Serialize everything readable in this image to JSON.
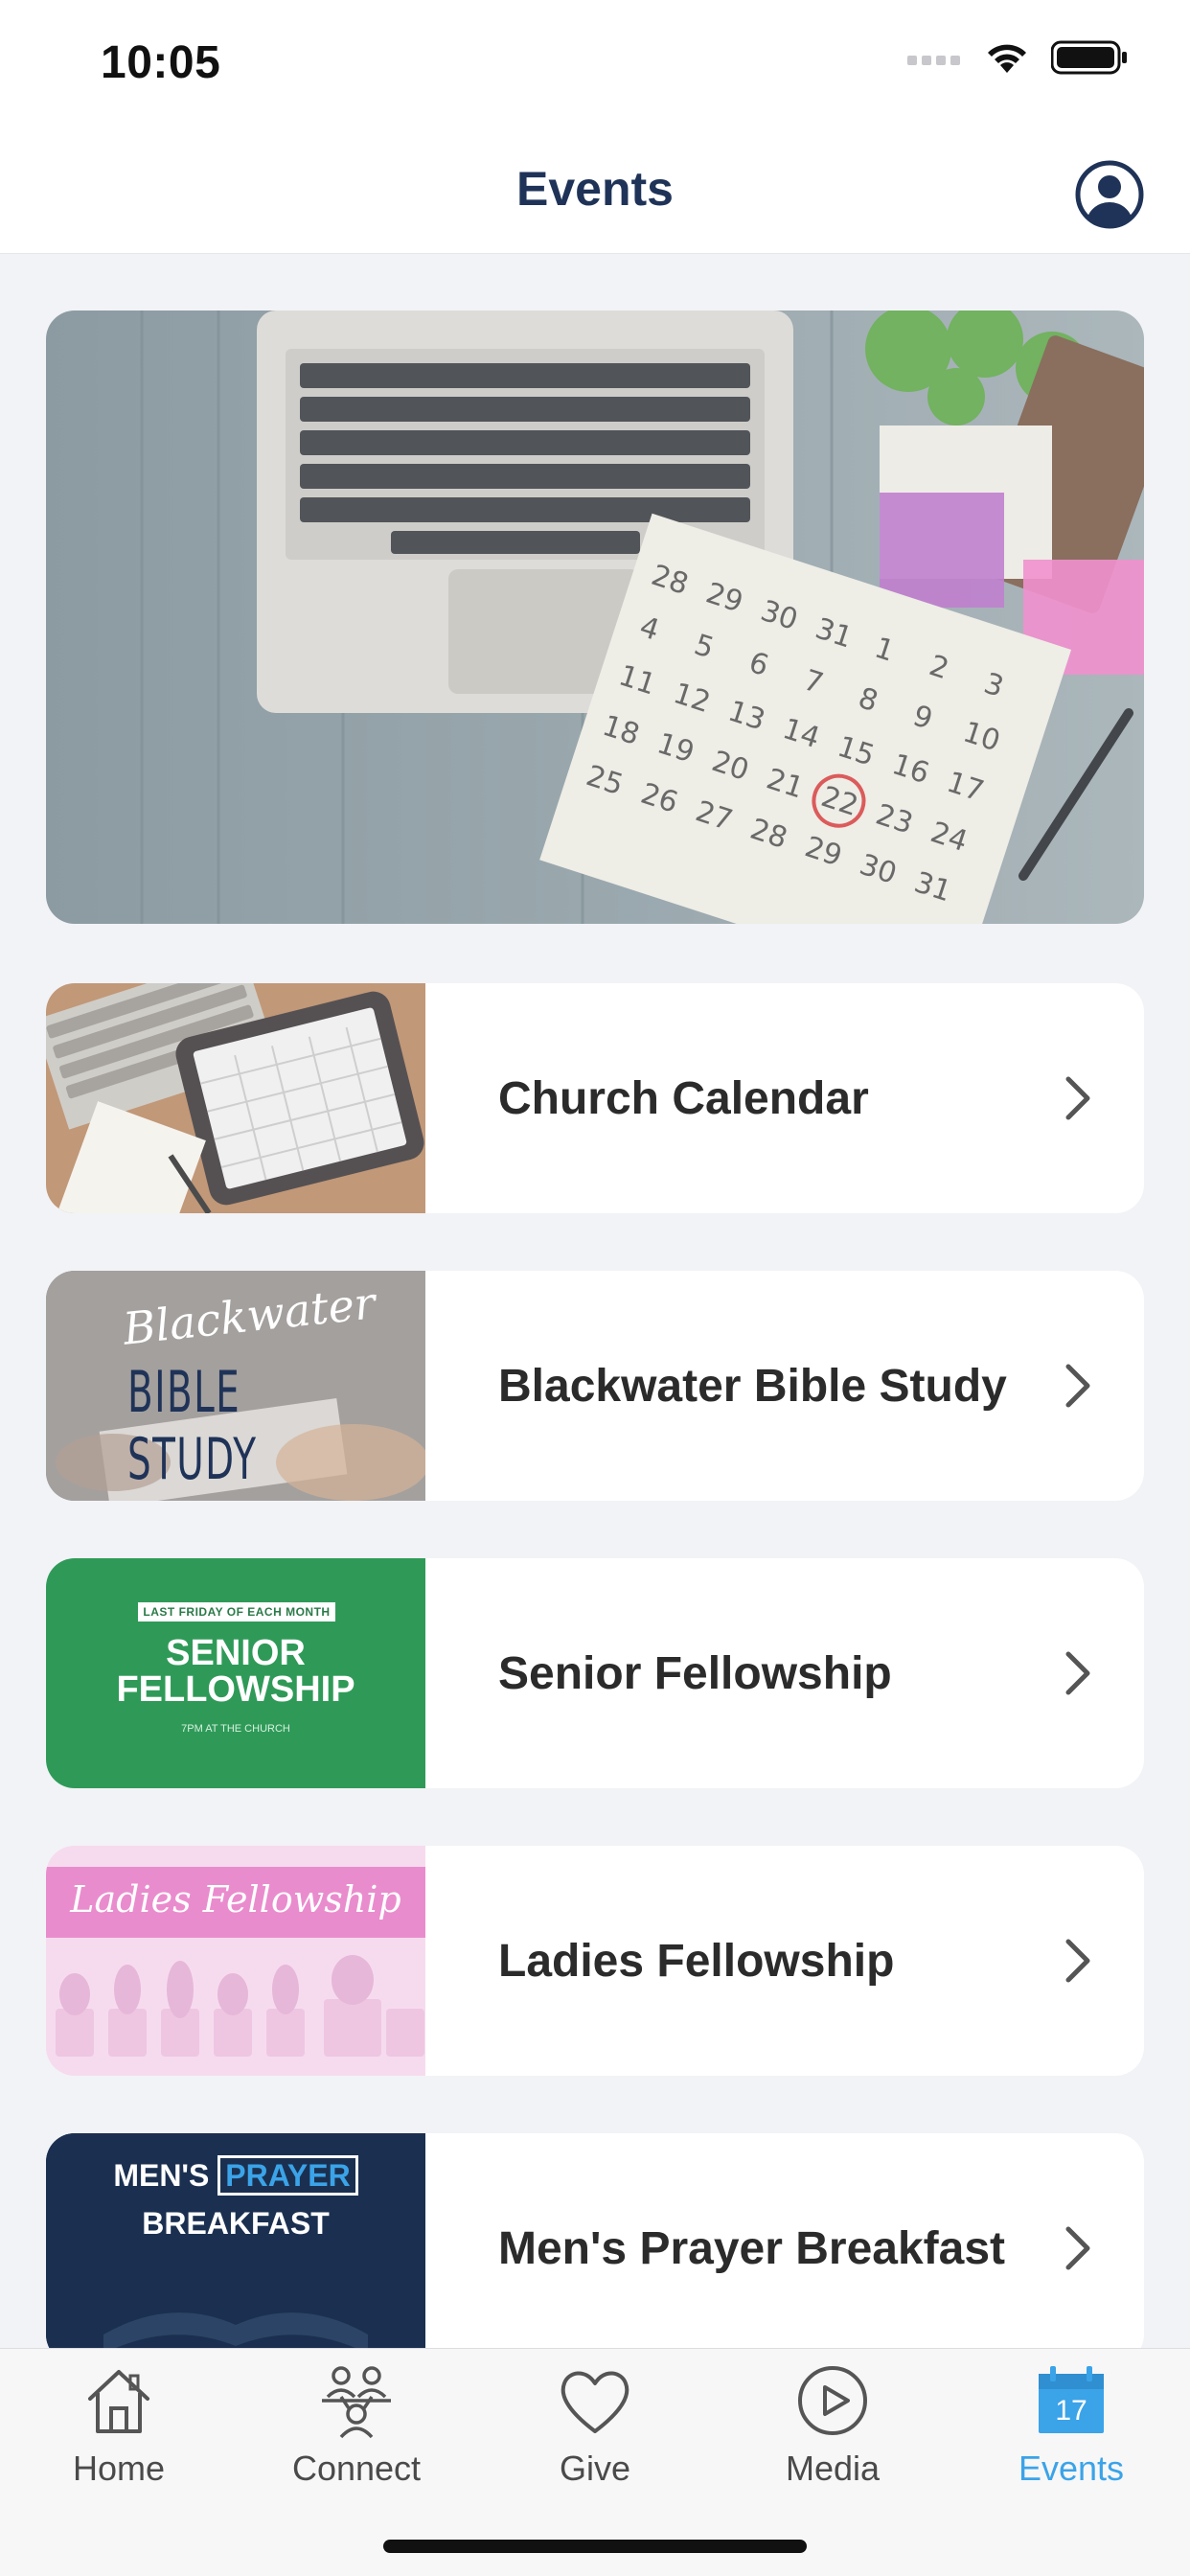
{
  "status_bar": {
    "time": "10:05"
  },
  "header": {
    "title": "Events",
    "profile_icon": "person-circle-icon"
  },
  "events": [
    {
      "title": "Church Calendar",
      "thumb_icon": "tablet-calendar-image"
    },
    {
      "title": "Blackwater Bible Study",
      "thumb_script": "Blackwater",
      "thumb_caps": "BIBLE STUDY"
    },
    {
      "title": "Senior Fellowship",
      "thumb_banner": "LAST FRIDAY OF EACH MONTH",
      "thumb_line1": "SENIOR",
      "thumb_line2": "FELLOWSHIP",
      "thumb_small": "7PM AT THE CHURCH"
    },
    {
      "title": "Ladies Fellowship",
      "thumb_script": "Ladies Fellowship"
    },
    {
      "title": "Men's Prayer Breakfast",
      "thumb_word1": "MEN'S",
      "thumb_word2": "PRAYER",
      "thumb_word3": "BREAKFAST"
    }
  ],
  "tabs": [
    {
      "label": "Home",
      "icon": "house-icon"
    },
    {
      "label": "Connect",
      "icon": "people-icon"
    },
    {
      "label": "Give",
      "icon": "heart-icon"
    },
    {
      "label": "Media",
      "icon": "play-circle-icon"
    },
    {
      "label": "Events",
      "icon": "calendar-icon",
      "badge": "17",
      "active": true
    }
  ],
  "colors": {
    "accent": "#3ba3e8",
    "title": "#1f3358",
    "background": "#f2f3f7"
  }
}
